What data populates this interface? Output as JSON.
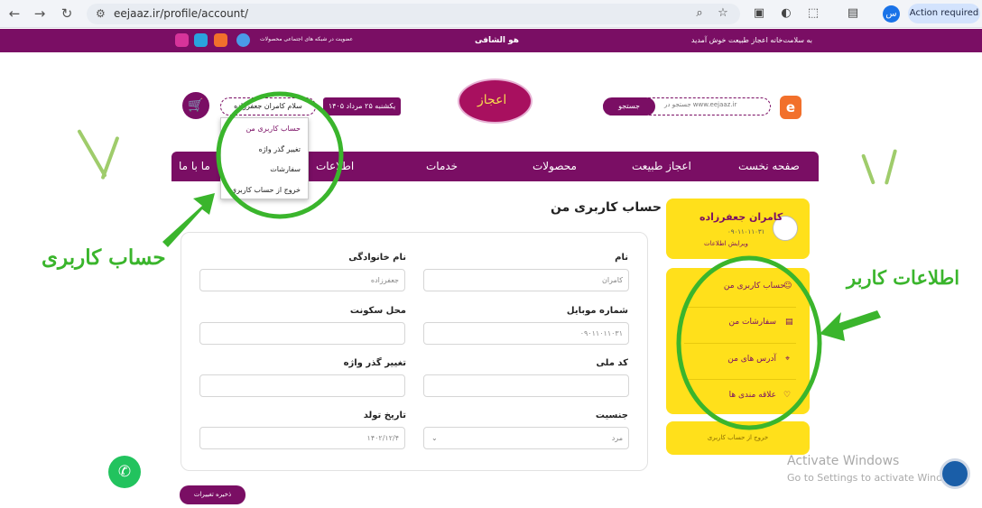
{
  "browser": {
    "url": "eejaaz.ir/profile/account/",
    "profile_initial": "س",
    "action_label": "Action required"
  },
  "topbar": {
    "welcome": "به سلامت‌خانه اعجاز طبیعت خوش آمدید",
    "hoshafi": "هو الشافی",
    "social_text": "عضویت در شبکه های اجتماعی محصولات"
  },
  "header": {
    "logo_text": "اعجاز",
    "search_placeholder": "جستجو در www.eejaaz.ir",
    "search_button": "جستجو",
    "date": "یکشنبه ۲۵ مرداد ۱۴۰۵",
    "greeting": "سلام کامران جعفرزاده"
  },
  "nav": {
    "items": [
      "صفحه نخست",
      "اعجاز طبیعت",
      "محصولات",
      "خدمات",
      "اطلاعات",
      "ما با ما"
    ]
  },
  "dropdown": {
    "items": [
      "حساب کاربری من",
      "تغییر گذر واژه",
      "سفارشات",
      "خروج از حساب کاربری"
    ]
  },
  "sidebar": {
    "name": "کامران جعفرزاده",
    "phone": "۰۹۰۱۱۰۱۱۰۳۱",
    "edit": "ویرایش اطلاعات",
    "menu": [
      "حساب کاربری من",
      "سفارشات من",
      "آدرس های من",
      "علاقه مندی ها"
    ],
    "logout": "خروج از حساب کاربری"
  },
  "form": {
    "title": "حساب کاربری من",
    "first_name_label": "نام",
    "first_name_value": "کامران",
    "last_name_label": "نام خانوادگی",
    "last_name_value": "جعفرزاده",
    "mobile_label": "شماره موبایل",
    "mobile_value": "۰۹۰۱۱۰۱۱۰۳۱",
    "residence_label": "محل سکونت",
    "residence_value": "",
    "national_label": "کد ملی",
    "national_value": "",
    "password_label": "تغییر گذر واژه",
    "password_value": "",
    "gender_label": "جنسیت",
    "gender_value": "مرد",
    "birth_label": "تاریخ تولد",
    "birth_value": "۱۴۰۲/۱۲/۴",
    "save": "ذخیره تغییرات"
  },
  "windows": {
    "line1": "Activate Windows",
    "line2": "Go to Settings to activate Windows."
  },
  "annotations": {
    "left": "حساب کاربری",
    "right": "اطلاعات کاربر"
  },
  "colors": {
    "brand": "#7a0e64",
    "accent": "#ffe01b",
    "annotation": "#3ab52c",
    "whatsapp": "#22c35e"
  }
}
